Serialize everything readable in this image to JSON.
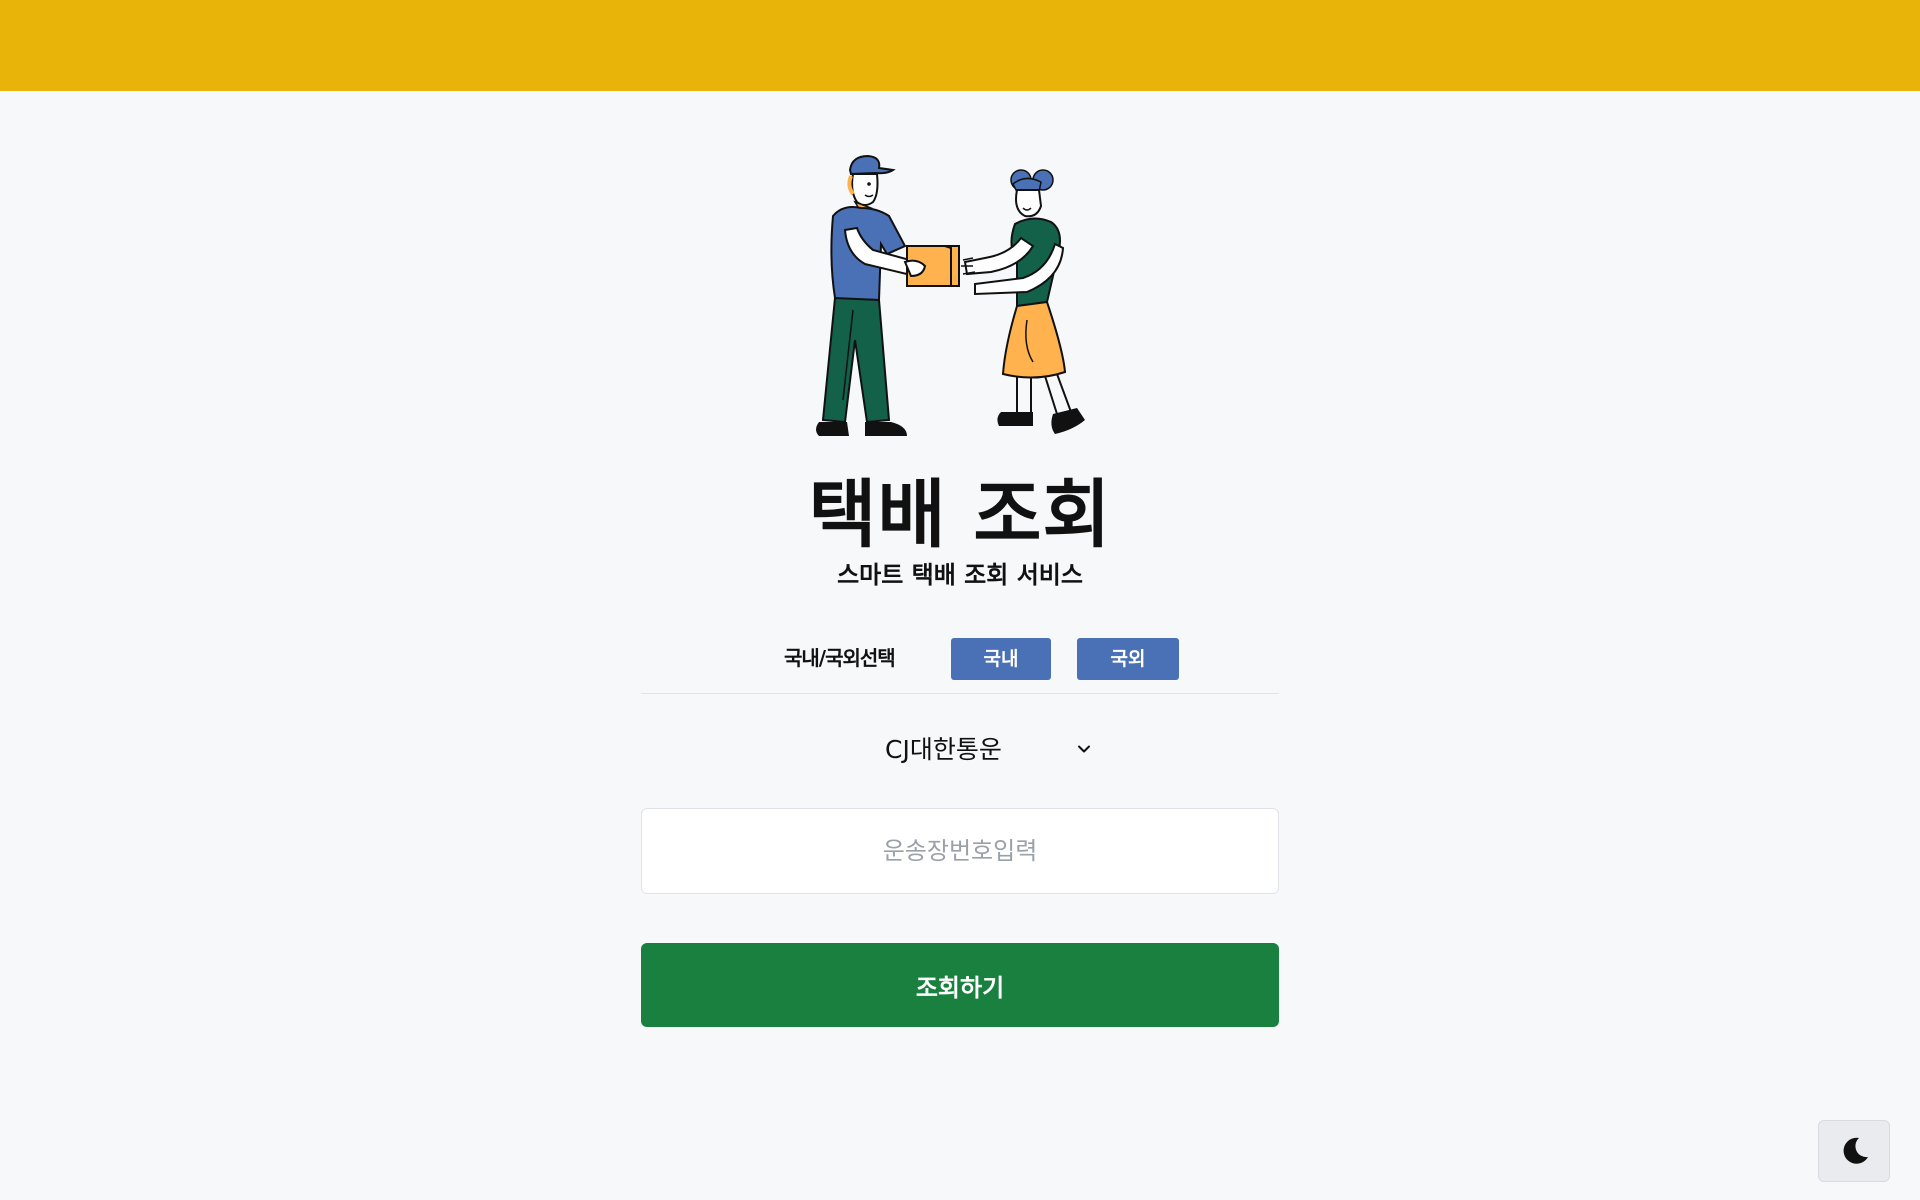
{
  "header": {
    "bar_color": "#e9b409"
  },
  "hero": {
    "illustration": "courier-handing-package-icon",
    "title": "택배 조회",
    "subtitle": "스마트 택배 조회 서비스"
  },
  "region": {
    "label": "국내/국외선택",
    "domestic_label": "국내",
    "international_label": "국외",
    "button_color": "#4a70b5"
  },
  "carrier": {
    "selected": "CJ대한통운",
    "icon": "chevron-down-icon"
  },
  "tracking": {
    "placeholder": "운송장번호입력",
    "value": ""
  },
  "submit": {
    "label": "조회하기",
    "color": "#19803f"
  },
  "theme": {
    "icon": "moon-icon"
  }
}
